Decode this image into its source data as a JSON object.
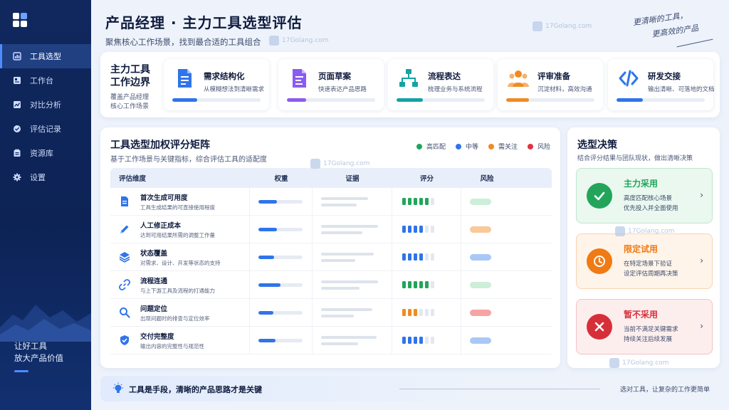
{
  "sidebar": {
    "items": [
      {
        "label": "工具选型",
        "icon": "tool-select-icon",
        "active": true
      },
      {
        "label": "工作台",
        "icon": "workbench-icon",
        "active": false
      },
      {
        "label": "对比分析",
        "icon": "compare-icon",
        "active": false
      },
      {
        "label": "评估记录",
        "icon": "record-icon",
        "active": false
      },
      {
        "label": "资源库",
        "icon": "library-icon",
        "active": false
      },
      {
        "label": "设置",
        "icon": "gear-icon",
        "active": false
      }
    ],
    "slogan_line1": "让好工具",
    "slogan_line2": "放大产品价值"
  },
  "header": {
    "title": "产品经理 · 主力工具选型评估",
    "subtitle": "聚焦核心工作场景，找到最合适的工具组合",
    "note_line1": "更清晰的工具，",
    "note_line2": "更高效的产品"
  },
  "tools": {
    "title_line1": "主力工具",
    "title_line2": "工作边界",
    "desc_line1": "覆盖产品经理",
    "desc_line2": "核心工作场景",
    "cards": [
      {
        "name": "需求结构化",
        "desc": "从模糊想法到清晰需求",
        "icon": "document-icon",
        "color": "#2f74ea",
        "progress": 0.28
      },
      {
        "name": "页面草案",
        "desc": "快速表达产品思路",
        "icon": "draft-icon",
        "color": "#8a5cf0",
        "progress": 0.22
      },
      {
        "name": "流程表达",
        "desc": "梳理业务与系统流程",
        "icon": "flowchart-icon",
        "color": "#14a3a3",
        "progress": 0.3
      },
      {
        "name": "评审准备",
        "desc": "沉淀材料，高效沟通",
        "icon": "team-icon",
        "color": "#f08a24",
        "progress": 0.26
      },
      {
        "name": "研发交接",
        "desc": "输出清晰、可落地的文档",
        "icon": "code-icon",
        "color": "#2f74ea",
        "progress": 0.3
      }
    ]
  },
  "matrix": {
    "title": "工具选型加权评分矩阵",
    "subtitle": "基于工作场景与关键指标，综合评估工具的适配度",
    "legend": [
      {
        "label": "高匹配",
        "color": "#22a55a"
      },
      {
        "label": "中等",
        "color": "#2f74ea"
      },
      {
        "label": "需关注",
        "color": "#f08a24"
      },
      {
        "label": "风险",
        "color": "#e0343e"
      }
    ],
    "columns": [
      "评估维度",
      "权重",
      "证据",
      "评分",
      "风险"
    ],
    "rows": [
      {
        "name": "首次生成可用度",
        "desc": "工具生成结果的可直接使用程度",
        "icon": "document-icon",
        "weight": 0.42,
        "score": 5,
        "score_color": "#22a55a",
        "risk_color": "#cdeed8"
      },
      {
        "name": "人工修正成本",
        "desc": "达到可用结果所需的调整工作量",
        "icon": "pencil-icon",
        "weight": 0.42,
        "score": 4,
        "score_color": "#2f74ea",
        "risk_color": "#f8c99a"
      },
      {
        "name": "状态覆盖",
        "desc": "对需求、设计、开发等状态的支持",
        "icon": "layers-icon",
        "weight": 0.36,
        "score": 4,
        "score_color": "#2f74ea",
        "risk_color": "#a9c8f7"
      },
      {
        "name": "流程连通",
        "desc": "与上下游工具及流程的打通能力",
        "icon": "link-icon",
        "weight": 0.5,
        "score": 5,
        "score_color": "#22a55a",
        "risk_color": "#cdeed8"
      },
      {
        "name": "问题定位",
        "desc": "出现问题时的排查与定位效率",
        "icon": "search-icon",
        "weight": 0.34,
        "score": 3,
        "score_color": "#f08a24",
        "risk_color": "#f6a3a6"
      },
      {
        "name": "交付完整度",
        "desc": "输出内容的完整性与规范性",
        "icon": "shield-check-icon",
        "weight": 0.38,
        "score": 4,
        "score_color": "#2f74ea",
        "risk_color": "#a9c8f7"
      }
    ]
  },
  "decision": {
    "title": "选型决策",
    "subtitle": "结合评分结果与团队现状，做出清晰决策",
    "cards": [
      {
        "title": "主力采用",
        "line1": "高度匹配核心场景",
        "line2": "优先投入并全面使用",
        "color": "#22a55a",
        "bg": "#eaf8ef",
        "border": "#bfe7cd",
        "icon": "check-icon"
      },
      {
        "title": "限定试用",
        "line1": "在特定场景下验证",
        "line2": "设定评估周期再决策",
        "color": "#f07a14",
        "bg": "#fff4ea",
        "border": "#f8d4b0",
        "icon": "clock-icon"
      },
      {
        "title": "暂不采用",
        "line1": "当前不满足关键需求",
        "line2": "持续关注后续发展",
        "color": "#d62f3a",
        "bg": "#fdeeee",
        "border": "#f3c2c5",
        "icon": "close-icon"
      }
    ]
  },
  "footer": {
    "main": "工具是手段，清晰的产品思路才是关键",
    "right": "选对工具，让复杂的工作更简单"
  },
  "watermark": "17Golang.com"
}
